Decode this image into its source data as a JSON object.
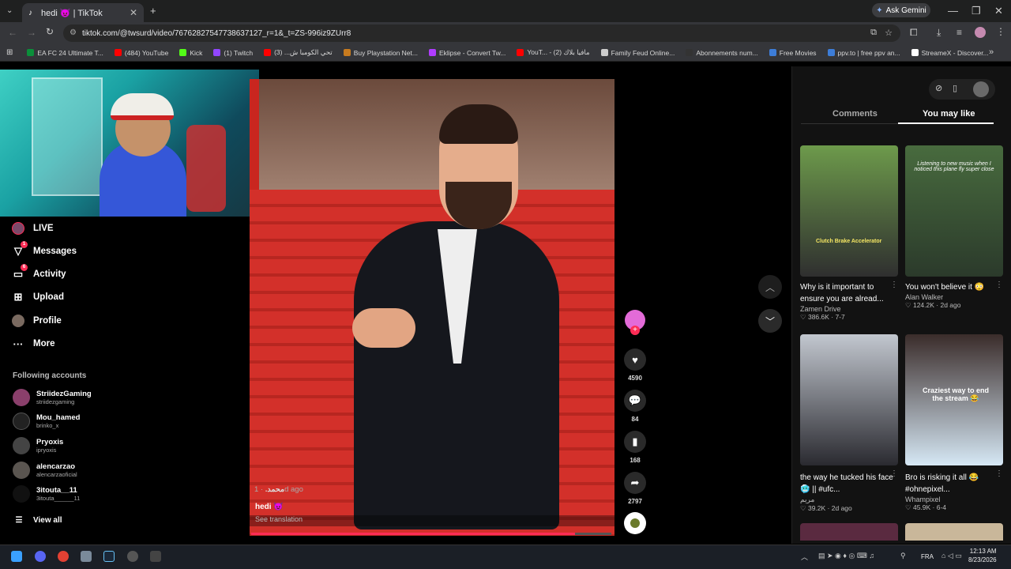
{
  "browser": {
    "tab_title": "hedi 😈 | TikTok",
    "ask_gemini": "Ask Gemini",
    "url": "tiktok.com/@twsurd/video/76762827547738637127_r=1&_t=ZS-996iz9ZUrr8"
  },
  "bookmarks": [
    {
      "label": "EA FC 24 Ultimate T...",
      "color": "#0b8f3a"
    },
    {
      "label": "(484) YouTube",
      "color": "#ff0000"
    },
    {
      "label": "Kick",
      "color": "#53fc18"
    },
    {
      "label": "(1) Twitch",
      "color": "#9146ff"
    },
    {
      "label": "تحي الكومبا ش... (3)",
      "color": "#ff0000"
    },
    {
      "label": "Buy Playstation Net...",
      "color": "#c77b1f"
    },
    {
      "label": "Eklipse - Convert Tw...",
      "color": "#b03cff"
    },
    {
      "label": "YouT... - مافيا بلاك (2)",
      "color": "#ff0000"
    },
    {
      "label": "Family Feud Online...",
      "color": "#cccccc"
    },
    {
      "label": "Abonnements num...",
      "color": "#333333"
    },
    {
      "label": "Free Movies",
      "color": "#3d7dd8"
    },
    {
      "label": "ppv.to | free ppv an...",
      "color": "#3d7dd8"
    },
    {
      "label": "StreameX - Discover...",
      "color": "#ffffff"
    }
  ],
  "nav": {
    "live": "LIVE",
    "messages": "Messages",
    "activity": "Activity",
    "upload": "Upload",
    "profile": "Profile",
    "more": "More",
    "messages_badge": "1",
    "activity_badge": "6"
  },
  "following": {
    "title": "Following accounts",
    "accounts": [
      {
        "name": "StriidezGaming",
        "handle": "striidezgaming"
      },
      {
        "name": "Mou_hamed",
        "handle": "brinko_x"
      },
      {
        "name": "Pryoxis",
        "handle": "ipryoxis"
      },
      {
        "name": "alencarzao",
        "handle": "alencarzaoficial"
      },
      {
        "name": "3itouta__11",
        "handle": "3itouta______11"
      }
    ],
    "view_all": "View all"
  },
  "video": {
    "author": "محمد.",
    "time": "· 1d ago",
    "caption": "hedi 😈",
    "see_translation": "See translation",
    "progress": 0.9
  },
  "actions": {
    "likes": "4590",
    "comments": "84",
    "saves": "168",
    "shares": "2797"
  },
  "panel": {
    "tab_comments": "Comments",
    "tab_you_may_like": "You may like",
    "cards": [
      {
        "title": "Why is it important to ensure you are alread...",
        "author": "Zamen Drive",
        "meta": "♡ 386.6K · 7-7",
        "thumb_top": "#6d9a4b",
        "thumb_bottom": "#2f2f2f",
        "overlay": "Clutch  Brake Accelerator"
      },
      {
        "title": "You won't believe it 😳",
        "author": "Alan Walker",
        "meta": "♡ 124.2K · 2d ago",
        "thumb_top": "#486b3e",
        "thumb_bottom": "#2b3a2b",
        "overlay": "Listening to new music when I noticed this plane fly super close"
      },
      {
        "title": "the way he tucked his face 🥶 || #ufc...",
        "author": "مريم",
        "meta": "♡ 39.2K · 2d ago",
        "thumb_top": "#c2c7cf",
        "thumb_bottom": "#2a2a30",
        "overlay": ""
      },
      {
        "title": "Bro is risking it all 😂 #ohnepixel...",
        "author": "Whampixel",
        "meta": "♡ 45.9K · 6-4",
        "thumb_top": "#3a2c2a",
        "thumb_bottom": "#d6e8f5",
        "overlay": "Craziest way to end the stream 😂"
      }
    ]
  },
  "taskbar": {
    "lang": "FRA",
    "time": "12:13 AM",
    "date": "8/23/2026"
  }
}
